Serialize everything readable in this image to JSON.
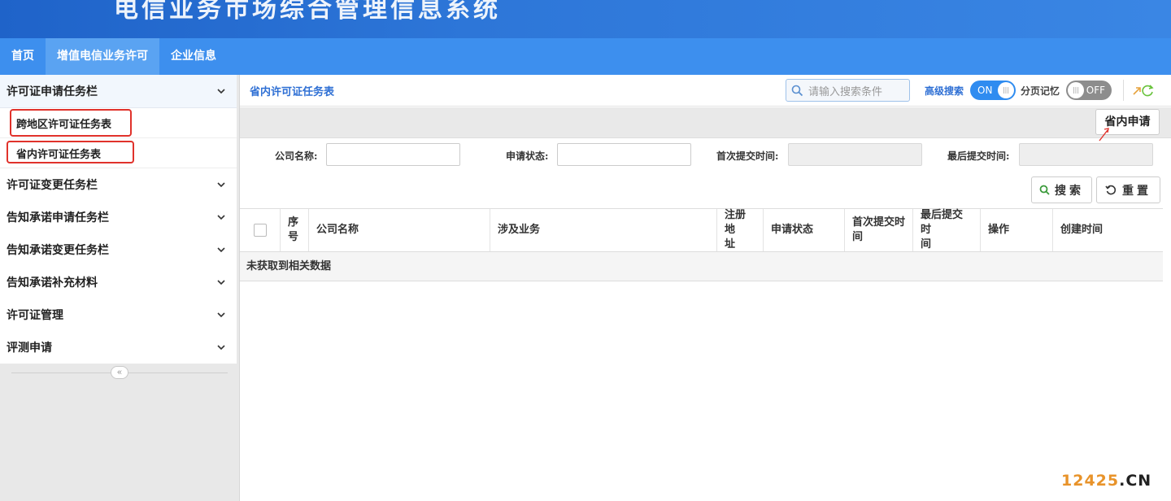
{
  "banner": {
    "title": "电信业务市场综合管理信息系统"
  },
  "nav": {
    "items": [
      {
        "label": "首页"
      },
      {
        "label": "增值电信业务许可"
      },
      {
        "label": "企业信息"
      }
    ]
  },
  "sidebar": {
    "groups": [
      {
        "label": "许可证申请任务栏"
      },
      {
        "label": "许可证变更任务栏"
      },
      {
        "label": "告知承诺申请任务栏"
      },
      {
        "label": "告知承诺变更任务栏"
      },
      {
        "label": "告知承诺补充材料"
      },
      {
        "label": "许可证管理"
      },
      {
        "label": "评测申请"
      }
    ],
    "sub_items": [
      {
        "label": "跨地区许可证任务表"
      },
      {
        "label": "省内许可证任务表"
      }
    ],
    "collapse_glyph": "«"
  },
  "toolbar": {
    "breadcrumb": "省内许可证任务表",
    "search_placeholder": "请输入搜索条件",
    "advanced_search_label": "高级搜索",
    "advanced_toggle": "ON",
    "page_memory_label": "分页记忆",
    "page_memory_toggle": "OFF"
  },
  "actions": {
    "apply_label": "省内申请"
  },
  "filters": {
    "company_label": "公司名称:",
    "status_label": "申请状态:",
    "first_submit_label": "首次提交时间:",
    "last_submit_label": "最后提交时间:"
  },
  "buttons": {
    "search_label": "搜索",
    "reset_label": "重置"
  },
  "table": {
    "columns": {
      "index_line1": "序",
      "index_line2": "号",
      "company": "公司名称",
      "business": "涉及业务",
      "address_line1": "注册地",
      "address_line2": "址",
      "status": "申请状态",
      "first_line1": "首次提交时",
      "first_line2": "间",
      "last_line1": "最后提交时",
      "last_line2": "间",
      "operation": "操作",
      "created": "创建时间"
    },
    "empty_text": "未获取到相关数据"
  },
  "watermark": {
    "number": "12425",
    "suffix": ".CN"
  },
  "colors": {
    "accent": "#3d8fee",
    "link": "#2e6fd4",
    "highlight": "#e0322b"
  }
}
